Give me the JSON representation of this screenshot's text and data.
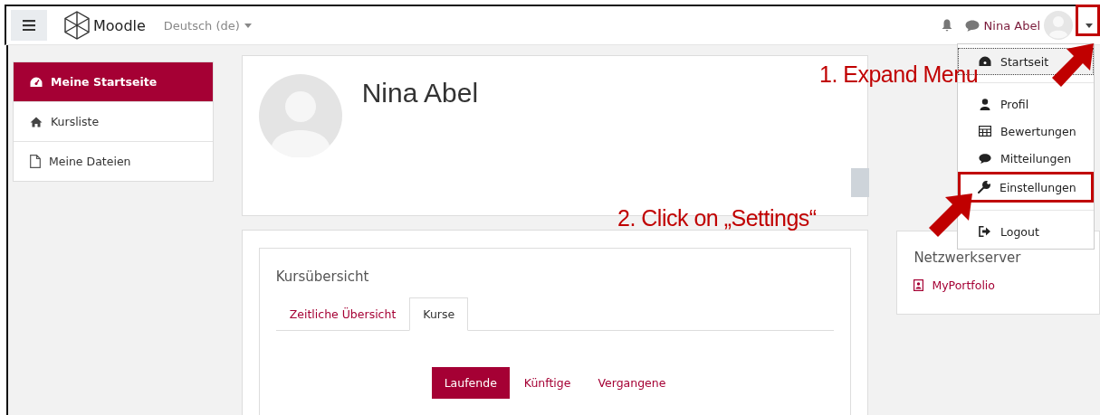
{
  "header": {
    "logo": "Moodle",
    "language": "Deutsch (de)",
    "user_name": "Nina Abel"
  },
  "sidebar": {
    "items": [
      {
        "label": "Meine Startseite",
        "selected": true
      },
      {
        "label": "Kursliste",
        "selected": false
      },
      {
        "label": "Meine Dateien",
        "selected": false
      }
    ]
  },
  "profile": {
    "name": "Nina Abel"
  },
  "course_overview": {
    "title": "Kursübersicht",
    "tabs": [
      {
        "label": "Zeitliche Übersicht",
        "selected": false
      },
      {
        "label": "Kurse",
        "selected": true
      }
    ],
    "filters": [
      {
        "label": "Laufende",
        "selected": true
      },
      {
        "label": "Künftige",
        "selected": false
      },
      {
        "label": "Vergangene",
        "selected": false
      }
    ]
  },
  "network_block": {
    "title": "Netzwerkserver",
    "link": "MyPortfolio"
  },
  "user_menu": {
    "groups": [
      [
        {
          "label": "Startseit",
          "focused": true,
          "marked": false
        }
      ],
      [
        {
          "label": "Profil",
          "focused": false,
          "marked": false
        },
        {
          "label": "Bewertungen",
          "focused": false,
          "marked": false
        },
        {
          "label": "Mitteilungen",
          "focused": false,
          "marked": false
        },
        {
          "label": "Einstellungen",
          "focused": false,
          "marked": true
        }
      ],
      [
        {
          "label": "Logout",
          "focused": false,
          "marked": false
        }
      ]
    ]
  },
  "annotations": [
    {
      "text": "1. Expand Menu"
    },
    {
      "text": "2. Click on „Settings“"
    }
  ]
}
